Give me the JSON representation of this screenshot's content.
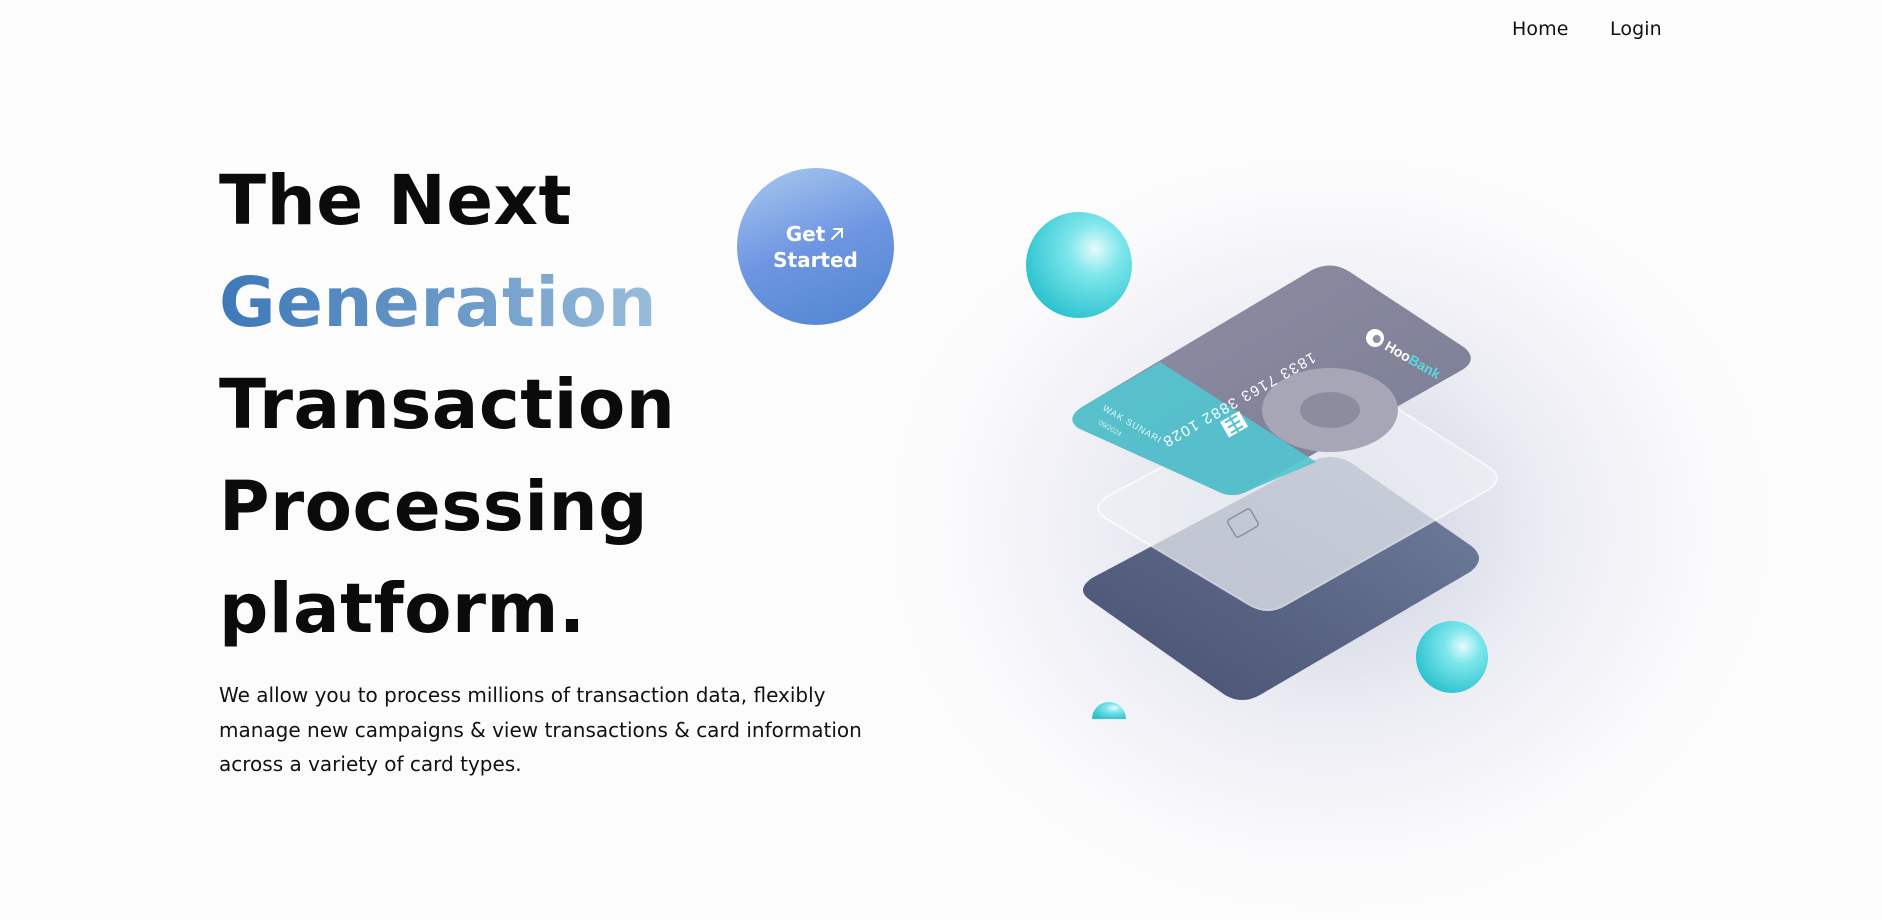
{
  "nav": {
    "home": "Home",
    "login": "Login"
  },
  "hero": {
    "line1": "The Next",
    "line2": "Generation",
    "line3": "Transaction",
    "line4": "Processing",
    "line5": "platform.",
    "description": "We allow you to process millions of transaction data, flexibly manage new campaigns & view transactions & card information across a variety of card types."
  },
  "cta": {
    "line1": "Get",
    "line2": "Started",
    "icon": "arrow-up-right-icon"
  },
  "card": {
    "brand_prefix": "Hoo",
    "brand_suffix": "Bank",
    "number": "1833 7163 3882 1028",
    "holder": "WAK SUNARI",
    "expiry": "09/2024"
  },
  "colors": {
    "accent_gradient_start": "#3d78b9",
    "accent_gradient_end": "#9fc0dd",
    "cta": "#6e95e2",
    "cyan": "#4fd6df"
  }
}
